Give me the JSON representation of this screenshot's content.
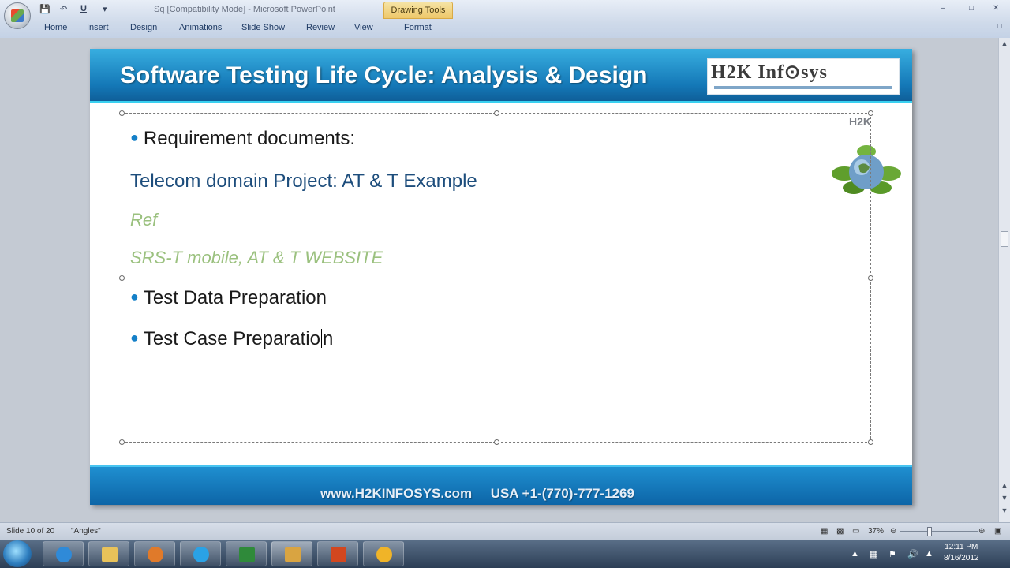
{
  "window": {
    "title": "Sq [Compatibility Mode] - Microsoft PowerPoint",
    "context_tab": "Drawing Tools"
  },
  "quick_access": {
    "save": "save-icon",
    "undo": "undo-icon",
    "redo": "redo-icon",
    "customize": "customize-icon"
  },
  "ribbon": {
    "tabs": [
      "Home",
      "Insert",
      "Design",
      "Animations",
      "Slide Show",
      "Review",
      "View",
      "Format"
    ]
  },
  "slide": {
    "title": "Software Testing Life Cycle: Analysis & Design",
    "logo_text": "H2K Inf⊙sys",
    "logo_small": "H2K",
    "lines": {
      "req_docs": "Requirement documents:",
      "telecom": "Telecom domain Project:  AT & T Example",
      "ref": "Ref",
      "srs": "SRS-T mobile,  AT & T WEBSITE",
      "test_data": "Test Data Preparation",
      "test_case_a": "Test Case Preparatio",
      "test_case_b": "n"
    },
    "footer": "www.H2KINFOSYS.com     USA +1-(770)-777-1269",
    "colors": {
      "header": "#1478b7",
      "accent_line": "#3ad0f0",
      "blue_text": "#1d4d7c",
      "green_text": "#9bc17f"
    }
  },
  "status": {
    "slide_indicator": "Slide 10 of 20",
    "theme": "\"Angles\"",
    "zoom": "37%"
  },
  "taskbar": {
    "apps": [
      "internet-explorer-icon",
      "file-explorer-icon",
      "media-player-icon",
      "skype-icon",
      "excel-icon",
      "paint-icon",
      "powerpoint-icon",
      "flower-app-icon"
    ],
    "clock_time": "12:11 PM",
    "clock_date": "8/16/2012"
  }
}
